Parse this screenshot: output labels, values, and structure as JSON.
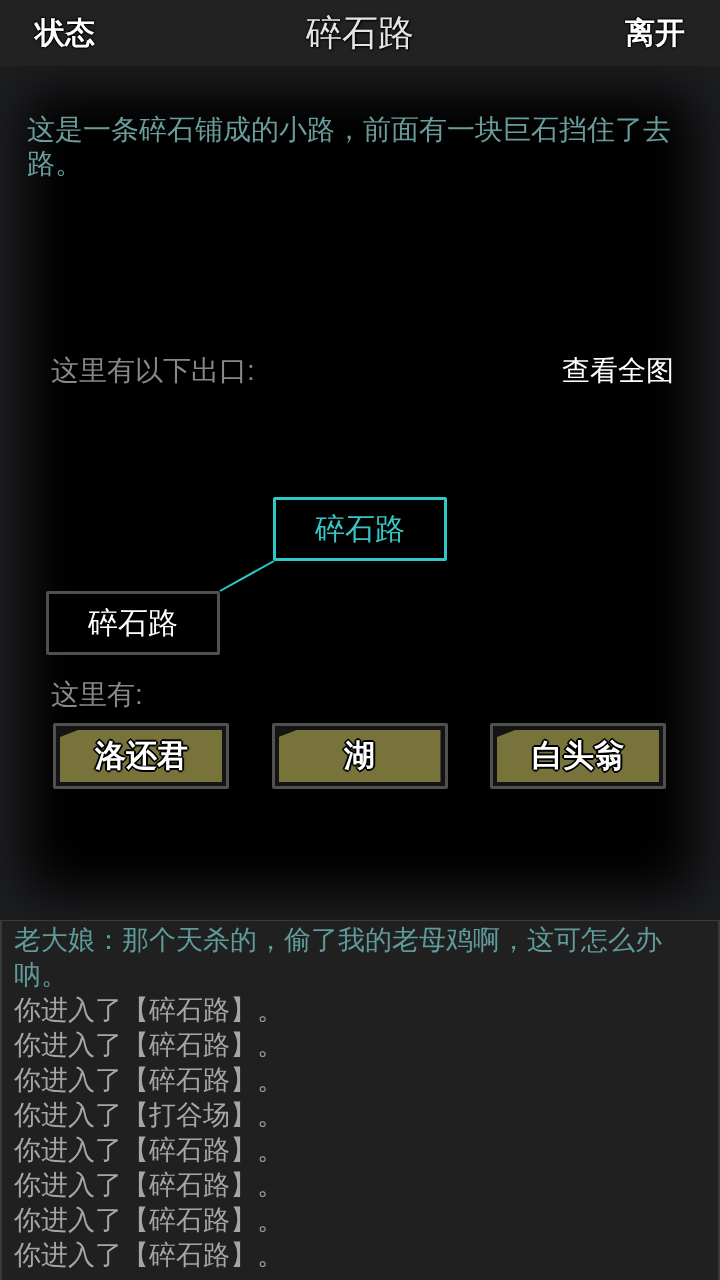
{
  "top_bar": {
    "left_button": "状态",
    "title": "碎石路",
    "right_button": "离开"
  },
  "description": "这是一条碎石铺成的小路，前面有一块巨石挡住了去路。",
  "exits": {
    "label": "这里有以下出口:",
    "map_button": "查看全图",
    "nodes": [
      {
        "label": "碎石路",
        "selected": true
      },
      {
        "label": "碎石路",
        "selected": false
      }
    ]
  },
  "presence": {
    "label": "这里有:",
    "items": [
      "洛还君",
      "湖",
      "白头翁"
    ]
  },
  "log": [
    {
      "kind": "dialogue",
      "text": "老大娘：那个天杀的，偷了我的老母鸡啊，这可怎么办呐。"
    },
    {
      "kind": "event",
      "text": "你进入了【碎石路】。"
    },
    {
      "kind": "event",
      "text": "你进入了【碎石路】。"
    },
    {
      "kind": "event",
      "text": "你进入了【碎石路】。"
    },
    {
      "kind": "event",
      "text": "你进入了【打谷场】。"
    },
    {
      "kind": "event",
      "text": "你进入了【碎石路】。"
    },
    {
      "kind": "event",
      "text": "你进入了【碎石路】。"
    },
    {
      "kind": "event",
      "text": "你进入了【碎石路】。"
    },
    {
      "kind": "event",
      "text": "你进入了【碎石路】。"
    }
  ]
}
